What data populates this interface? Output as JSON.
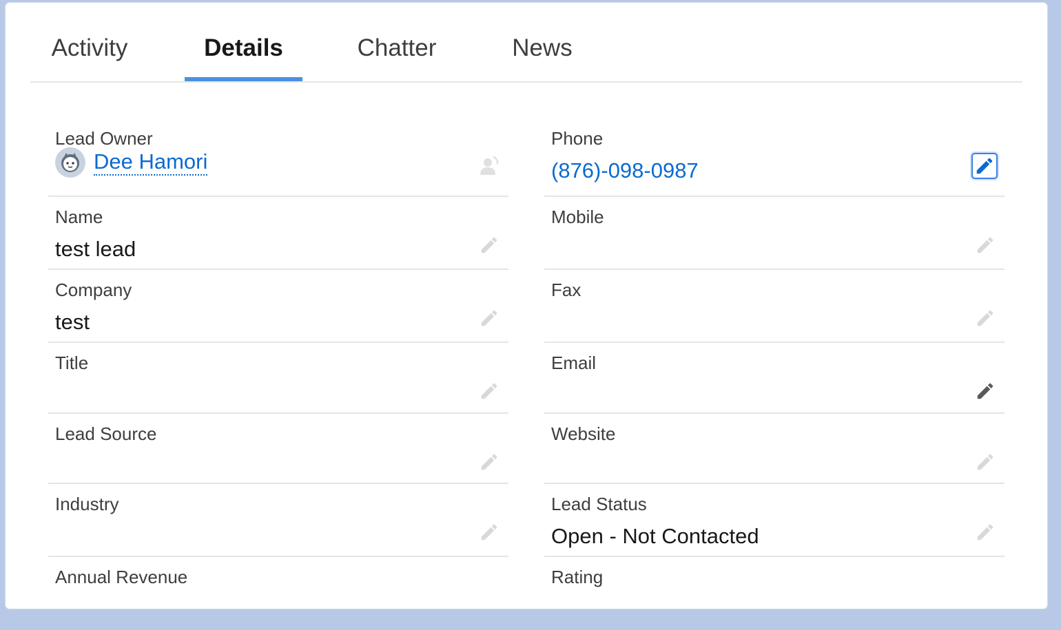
{
  "tabs": [
    {
      "label": "Activity",
      "active": false
    },
    {
      "label": "Details",
      "active": true
    },
    {
      "label": "Chatter",
      "active": false
    },
    {
      "label": "News",
      "active": false
    }
  ],
  "fields": {
    "lead_owner": {
      "label": "Lead Owner",
      "value": "Dee Hamori"
    },
    "phone": {
      "label": "Phone",
      "value": "(876)-098-0987"
    },
    "name": {
      "label": "Name",
      "value": "test lead"
    },
    "mobile": {
      "label": "Mobile",
      "value": ""
    },
    "company": {
      "label": "Company",
      "value": "test"
    },
    "fax": {
      "label": "Fax",
      "value": ""
    },
    "title": {
      "label": "Title",
      "value": ""
    },
    "email": {
      "label": "Email",
      "value": ""
    },
    "lead_source": {
      "label": "Lead Source",
      "value": ""
    },
    "website": {
      "label": "Website",
      "value": ""
    },
    "industry": {
      "label": "Industry",
      "value": ""
    },
    "lead_status": {
      "label": "Lead Status",
      "value": "Open - Not Contacted"
    },
    "annual_revenue": {
      "label": "Annual Revenue",
      "value": ""
    },
    "rating": {
      "label": "Rating",
      "value": ""
    }
  },
  "icons": {
    "edit": "pencil-icon",
    "change_owner": "change-owner-icon",
    "avatar": "avatar-icon"
  },
  "colors": {
    "accent": "#4a90e2",
    "link": "#0b6ad1",
    "background": "#b7c9e6"
  }
}
